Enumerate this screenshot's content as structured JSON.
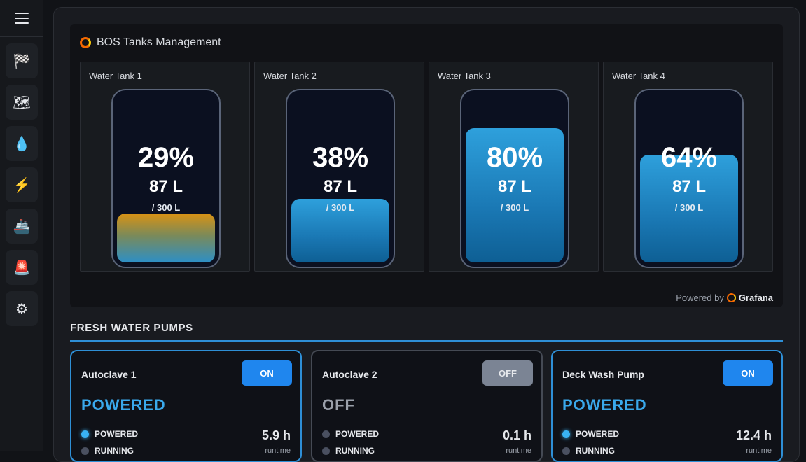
{
  "dashboard": {
    "title": "BOS Tanks Management",
    "powered_by": "Powered by",
    "brand": "Grafana",
    "tanks": [
      {
        "name": "Water Tank 1",
        "percent": "29%",
        "level": 0.29,
        "liters": "87 L",
        "capacity": "/ 300 L",
        "fill_style": "orange"
      },
      {
        "name": "Water Tank 2",
        "percent": "38%",
        "level": 0.38,
        "liters": "87 L",
        "capacity": "/ 300 L",
        "fill_style": "blue"
      },
      {
        "name": "Water Tank 3",
        "percent": "80%",
        "level": 0.8,
        "liters": "87 L",
        "capacity": "/ 300 L",
        "fill_style": "blue"
      },
      {
        "name": "Water Tank 4",
        "percent": "64%",
        "level": 0.64,
        "liters": "87 L",
        "capacity": "/ 300 L",
        "fill_style": "blue"
      }
    ]
  },
  "sidebar": {
    "items": [
      {
        "name": "race-flag",
        "icon": "🏁"
      },
      {
        "name": "map",
        "icon": "🗺"
      },
      {
        "name": "water-drop",
        "icon": "💧"
      },
      {
        "name": "lightning",
        "icon": "⚡"
      },
      {
        "name": "ship",
        "icon": "🚢"
      },
      {
        "name": "alarm-light",
        "icon": "🚨"
      },
      {
        "name": "gear",
        "icon": "⚙"
      }
    ]
  },
  "pumps": {
    "section_title": "FRESH WATER PUMPS",
    "items": [
      {
        "name": "Autoclave 1",
        "toggle": "ON",
        "state": "POWERED",
        "status_powered": "POWERED",
        "status_running": "RUNNING",
        "runtime": "5.9 h",
        "runtime_label": "runtime"
      },
      {
        "name": "Autoclave 2",
        "toggle": "OFF",
        "state": "OFF",
        "status_powered": "POWERED",
        "status_running": "RUNNING",
        "runtime": "0.1 h",
        "runtime_label": "runtime"
      },
      {
        "name": "Deck Wash Pump",
        "toggle": "ON",
        "state": "POWERED",
        "status_powered": "POWERED",
        "status_running": "RUNNING",
        "runtime": "12.4 h",
        "runtime_label": "runtime"
      }
    ]
  },
  "colors": {
    "accent": "#2e8fd6",
    "toggle_on": "#1f86ee",
    "toggle_off": "#7b8494",
    "powered_text": "#3aa9ec",
    "grafana_orange": "#f46800"
  }
}
